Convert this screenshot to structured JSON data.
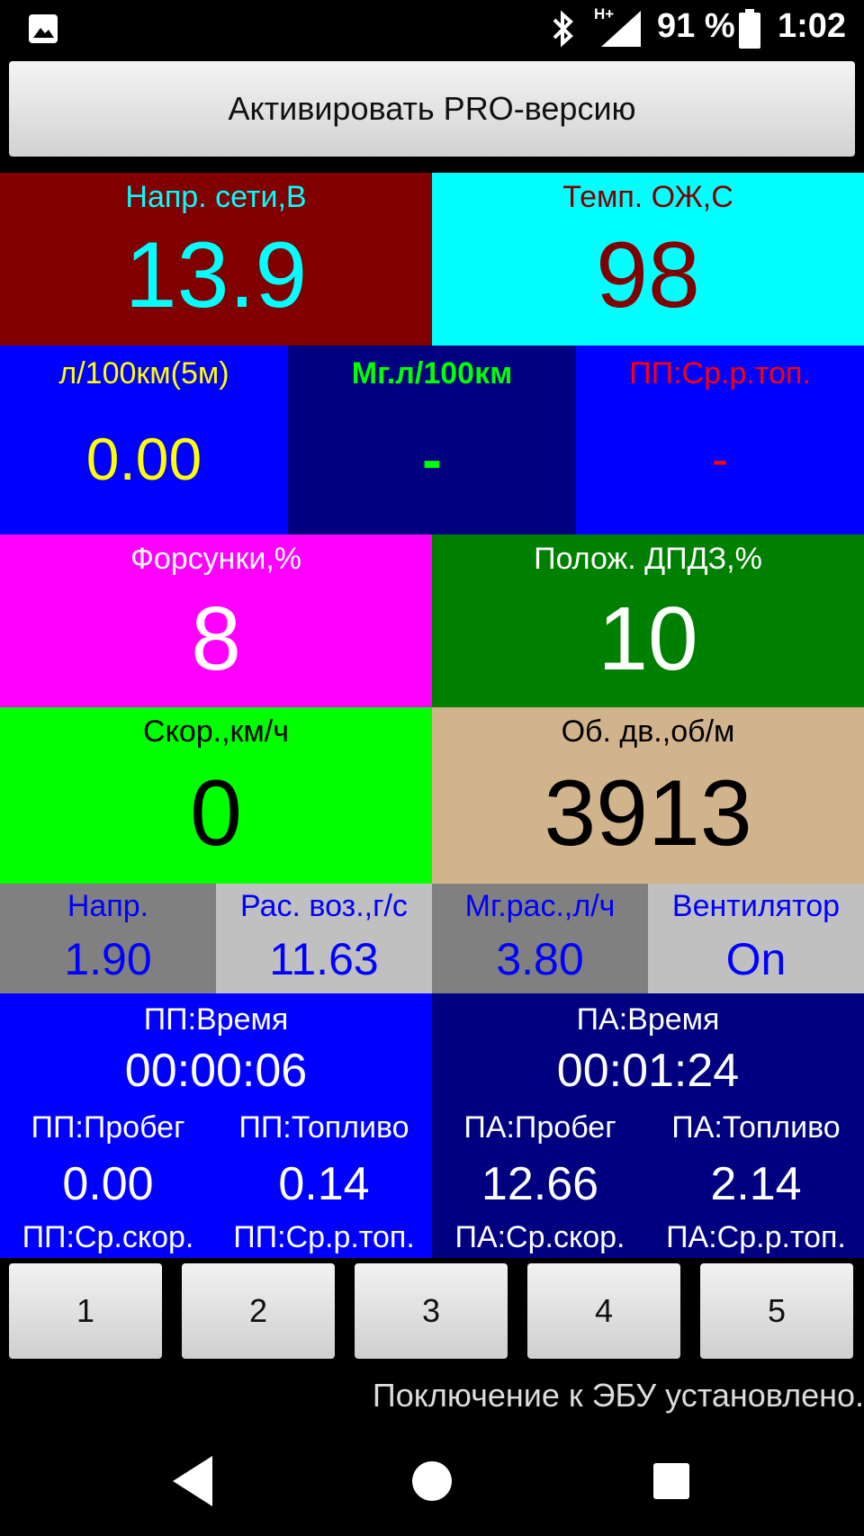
{
  "status_bar": {
    "battery": "91 %",
    "time": "1:02",
    "network_label": "H+",
    "icons": [
      "image-icon",
      "bluetooth-icon",
      "signal-icon",
      "battery-icon"
    ]
  },
  "pro_button": "Активировать PRO-версию",
  "tiles": {
    "voltage": {
      "label": "Напр. сети,В",
      "value": "13.9",
      "bg": "#800000",
      "fg": "#00ffff"
    },
    "coolant": {
      "label": "Темп. ОЖ,С",
      "value": "98",
      "bg": "#00ffff",
      "fg": "#800000"
    },
    "fuel5m": {
      "label": "л/100км(5м)",
      "value": "0.00",
      "bg": "#0000ff",
      "fg": "#ffff00"
    },
    "fuel_inst": {
      "label": "Мг.л/100км",
      "value": "-",
      "bg": "#000080",
      "fg": "#00ff00"
    },
    "fuel_avg": {
      "label": "ПП:Ср.р.топ.",
      "value": "-",
      "bg": "#0000ff",
      "fg": "#ff0000"
    },
    "injectors": {
      "label": "Форсунки,%",
      "value": "8",
      "bg": "#ff00ff",
      "fg": "#ffffff"
    },
    "throttle": {
      "label": "Полож. ДПДЗ,%",
      "value": "10",
      "bg": "#008000",
      "fg": "#ffffff"
    },
    "speed": {
      "label": "Скор.,км/ч",
      "value": "0",
      "bg": "#00ff00",
      "fg": "#000000"
    },
    "rpm": {
      "label": "Об. дв.,об/м",
      "value": "3913",
      "bg": "#d2b48c",
      "fg": "#000000"
    },
    "sensor_v": {
      "label": "Напр.",
      "value": "1.90",
      "bg": "#808080",
      "fg": "#0000ff"
    },
    "airflow": {
      "label": "Рас. воз.,г/с",
      "value": "11.63",
      "bg": "#c0c0c0",
      "fg": "#0000ff"
    },
    "fuel_rate": {
      "label": "Мг.рас.,л/ч",
      "value": "3.80",
      "bg": "#808080",
      "fg": "#0000ff"
    },
    "fan": {
      "label": "Вентилятор",
      "value": "On",
      "bg": "#c0c0c0",
      "fg": "#0000ff"
    }
  },
  "trip_current": {
    "bg": "#0000ff",
    "time_label": "ПП:Время",
    "time_value": "00:00:06",
    "dist_label": "ПП:Пробег",
    "dist_value": "0.00",
    "fuel_label": "ПП:Топливо",
    "fuel_value": "0.14",
    "avg_speed_label": "ПП:Ср.скор.",
    "avg_fuel_label": "ПП:Ср.р.топ."
  },
  "trip_total": {
    "bg": "#000080",
    "time_label": "ПА:Время",
    "time_value": "00:01:24",
    "dist_label": "ПА:Пробег",
    "dist_value": "12.66",
    "fuel_label": "ПА:Топливо",
    "fuel_value": "2.14",
    "avg_speed_label": "ПА:Ср.скор.",
    "avg_fuel_label": "ПА:Ср.р.топ."
  },
  "page_buttons": [
    "1",
    "2",
    "3",
    "4",
    "5"
  ],
  "connection_status": "Поключение к ЭБУ установлено.",
  "nav": {
    "icons": [
      "back-icon",
      "home-icon",
      "recents-icon"
    ]
  }
}
